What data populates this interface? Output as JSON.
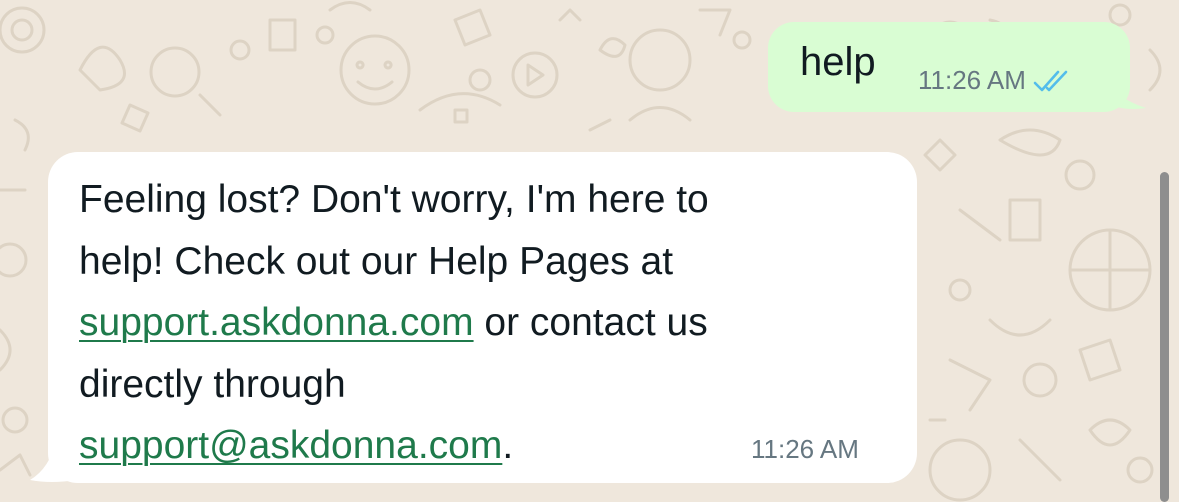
{
  "chat": {
    "outgoing": {
      "text": "help",
      "time": "11:26 AM",
      "status_icon": "double-check-read-icon",
      "bubble_color": "#d9fdd3"
    },
    "incoming": {
      "line1": "Feeling lost? Don't worry, I'm here to",
      "line2": "help! Check out our Help Pages at",
      "link_help": "support.askdonna.com",
      "line3_rest": " or contact us",
      "line4": "directly through",
      "link_email": "support@askdonna.com",
      "line5_rest": ".",
      "time": "11:26 AM",
      "bubble_color": "#ffffff"
    }
  },
  "colors": {
    "wallpaper": "#efe7dc",
    "link": "#1f7a4b",
    "read_ticks": "#53bdeb"
  }
}
